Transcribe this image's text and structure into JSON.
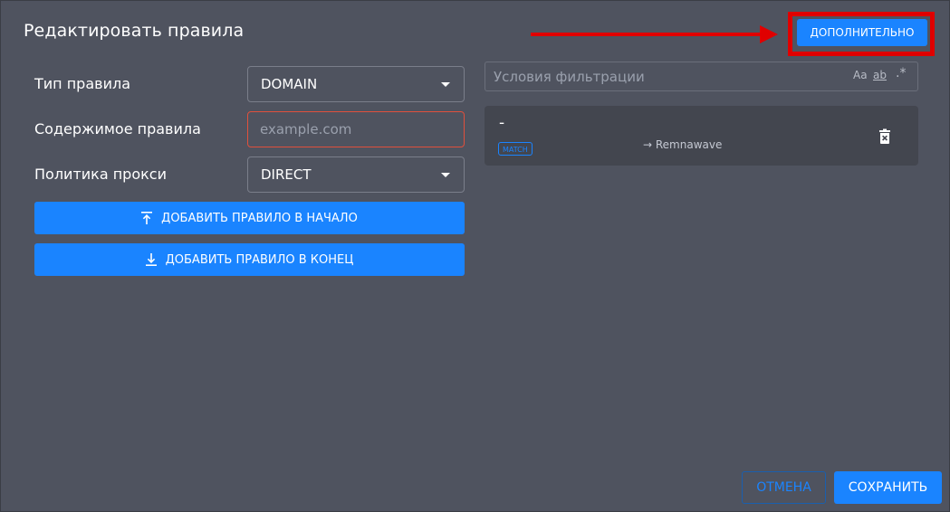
{
  "dialog": {
    "title": "Редактировать правила",
    "advanced_label": "ДОПОЛНИТЕЛЬНО"
  },
  "form": {
    "rule_type": {
      "label": "Тип правила",
      "value": "DOMAIN"
    },
    "rule_content": {
      "label": "Содержимое правила",
      "placeholder": "example.com",
      "value": ""
    },
    "proxy_policy": {
      "label": "Политика прокси",
      "value": "DIRECT"
    },
    "add_to_start_label": "ДОБАВИТЬ ПРАВИЛО В НАЧАЛО",
    "add_to_end_label": "ДОБАВИТЬ ПРАВИЛО В КОНЕЦ"
  },
  "filter": {
    "placeholder": "Условия фильтрации",
    "options": [
      "Aa",
      "ab",
      ".*"
    ]
  },
  "rules": [
    {
      "title": "-",
      "badge": "MATCH",
      "target": "→ Remnawave"
    }
  ],
  "footer": {
    "cancel_label": "ОТМЕНА",
    "save_label": "СОХРАНИТЬ"
  },
  "colors": {
    "accent": "#1a84ff",
    "dialog_bg": "#4f535f",
    "card_bg": "#43464f",
    "error_border": "#e0503c",
    "annotation_red": "#e00000"
  }
}
